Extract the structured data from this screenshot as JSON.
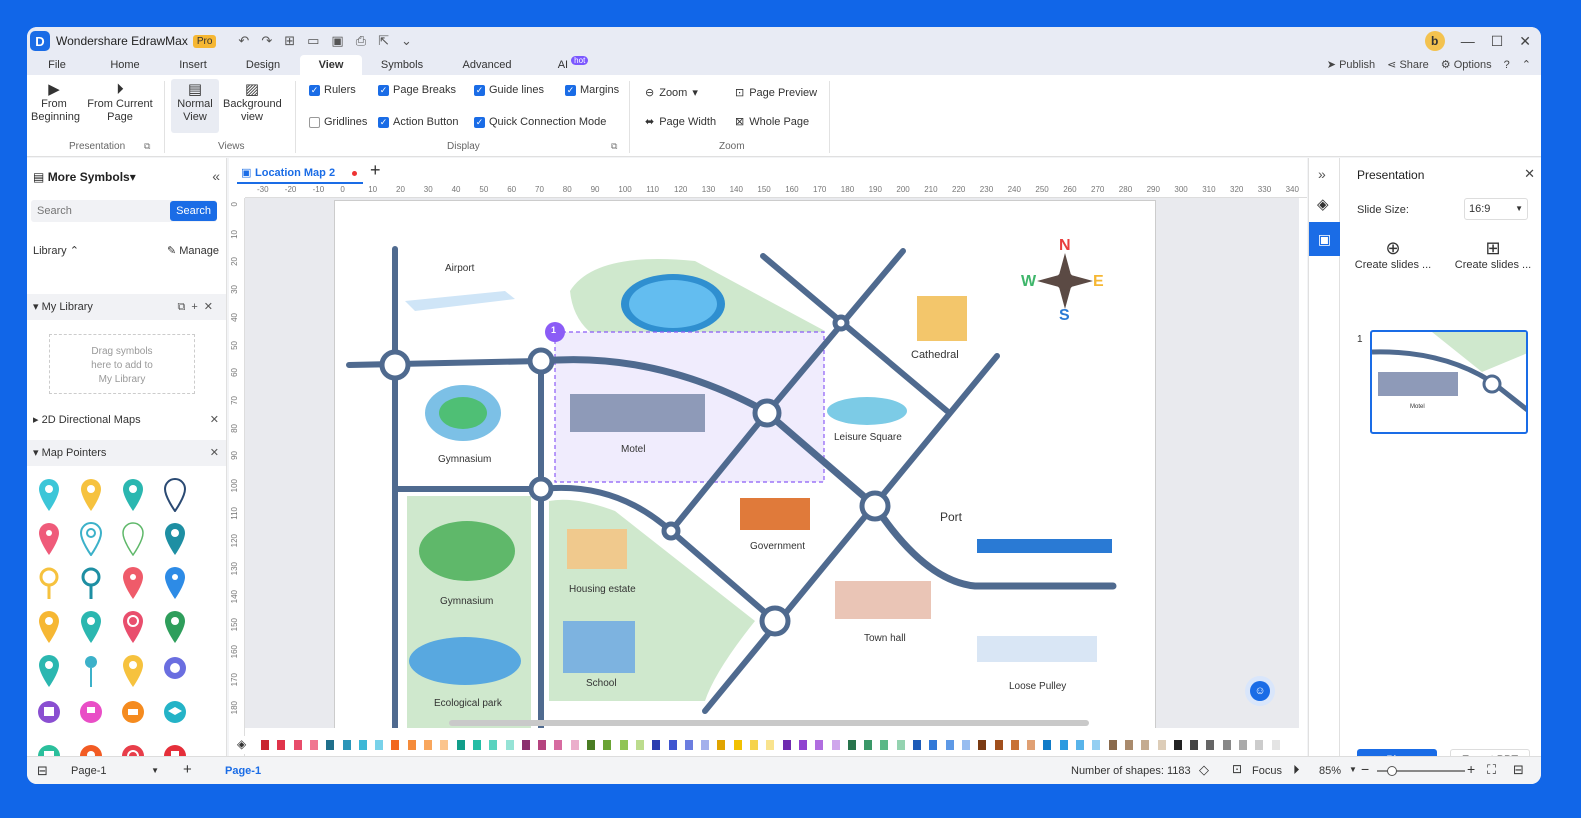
{
  "app": {
    "name": "Wondershare EdrawMax",
    "badge": "Pro",
    "avatar_letter": "b"
  },
  "menu": {
    "tabs": [
      "File",
      "Home",
      "Insert",
      "Design",
      "View",
      "Symbols",
      "Advanced",
      "AI"
    ],
    "ai_badge": "hot",
    "active": "View",
    "right": {
      "publish": "Publish",
      "share": "Share",
      "options": "Options"
    }
  },
  "ribbon": {
    "presentation": {
      "from_beginning": "From\nBeginning",
      "from_current": "From Current\nPage",
      "group": "Presentation"
    },
    "views": {
      "normal": "Normal\nView",
      "background": "Background\nview",
      "group": "Views"
    },
    "display": {
      "rulers": "Rulers",
      "page_breaks": "Page Breaks",
      "guide_lines": "Guide lines",
      "margins": "Margins",
      "gridlines": "Gridlines",
      "action_button": "Action Button",
      "quick_conn": "Quick Connection Mode",
      "group": "Display"
    },
    "zoom": {
      "zoom": "Zoom",
      "page_preview": "Page Preview",
      "page_width": "Page Width",
      "whole_page": "Whole Page",
      "group": "Zoom"
    }
  },
  "left": {
    "title": "More Symbols",
    "search_placeholder": "Search",
    "search_btn": "Search",
    "library": "Library",
    "manage": "Manage",
    "my_library": "My Library",
    "drop_hint": "Drag symbols\nhere to add to\nMy Library",
    "directional": "2D Directional Maps",
    "pointers": "Map Pointers"
  },
  "doc": {
    "tab": "Location Map 2"
  },
  "ruler": {
    "h": [
      "-30",
      "-20",
      "-10",
      "0",
      "10",
      "20",
      "30",
      "40",
      "50",
      "60",
      "70",
      "80",
      "90",
      "100",
      "110",
      "120",
      "130",
      "140",
      "150",
      "160",
      "170",
      "180",
      "190",
      "200",
      "210",
      "220",
      "230",
      "240",
      "250",
      "260",
      "270",
      "280",
      "290",
      "300",
      "310",
      "320",
      "330",
      "340"
    ],
    "v": [
      "0",
      "10",
      "20",
      "30",
      "40",
      "50",
      "60",
      "70",
      "80",
      "90",
      "100",
      "110",
      "120",
      "130",
      "140",
      "150",
      "160",
      "170",
      "180"
    ]
  },
  "map": {
    "airport": "Airport",
    "gymnasium1": "Gymnasium",
    "motel": "Motel",
    "leisure": "Leisure Square",
    "cathedral": "Cathedral",
    "gymnasium2": "Gymnasium",
    "housing": "Housing estate",
    "government": "Government",
    "port": "Port",
    "school": "School",
    "townhall": "Town hall",
    "eco": "Ecological park",
    "loose": "Loose Pulley",
    "compass": {
      "n": "N",
      "s": "S",
      "e": "E",
      "w": "W"
    },
    "marker": "1"
  },
  "right": {
    "title": "Presentation",
    "slide_size_label": "Slide Size:",
    "slide_size": "16:9",
    "create1": "Create slides ...",
    "create2": "Create slides ...",
    "slide_num": "1",
    "thumb_label": "Motel",
    "play": "Play",
    "export": "Export PPT"
  },
  "status": {
    "page_select": "Page-1",
    "page_tab": "Page-1",
    "shapes": "Number of shapes: 1183",
    "focus": "Focus",
    "zoom": "85%"
  },
  "colors": {
    "accent": "#1a6ce6",
    "road": "#4f6a8f",
    "park": "#cfe8cd",
    "selection": "#8b5cf6"
  }
}
